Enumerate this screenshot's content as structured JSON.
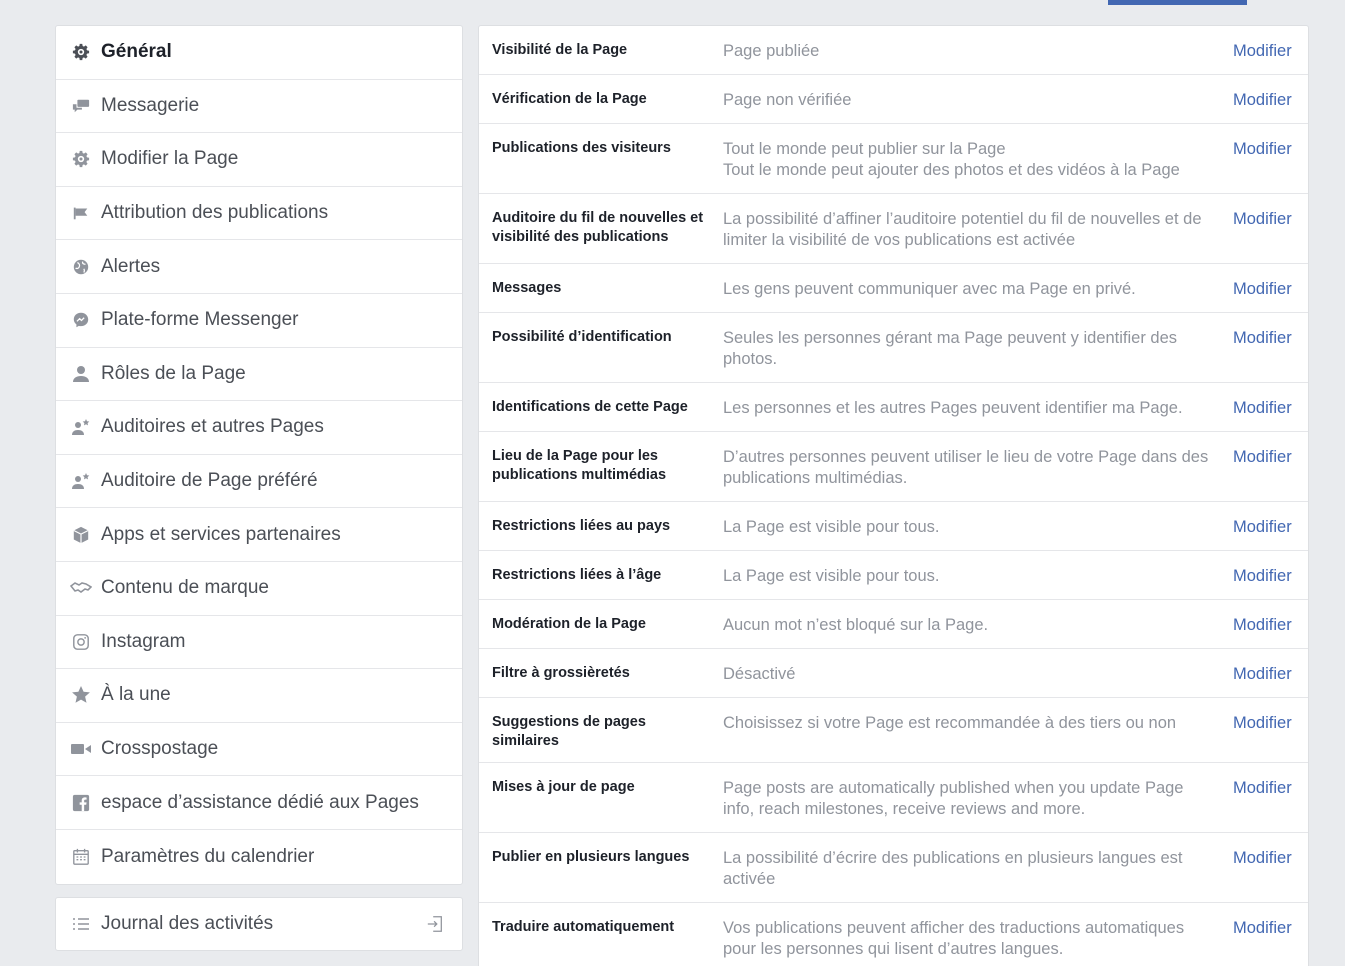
{
  "sidebar": {
    "items": [
      {
        "label": "Général",
        "icon": "gear-icon",
        "active": true
      },
      {
        "label": "Messagerie",
        "icon": "chat-bubbles-icon"
      },
      {
        "label": "Modifier la Page",
        "icon": "gear-icon"
      },
      {
        "label": "Attribution des publications",
        "icon": "flag-icon"
      },
      {
        "label": "Alertes",
        "icon": "globe-icon"
      },
      {
        "label": "Plate-forme Messenger",
        "icon": "messenger-icon"
      },
      {
        "label": "Rôles de la Page",
        "icon": "person-icon"
      },
      {
        "label": "Auditoires et autres Pages",
        "icon": "people-star-icon"
      },
      {
        "label": "Auditoire de Page préféré",
        "icon": "people-star-icon"
      },
      {
        "label": "Apps et services partenaires",
        "icon": "cube-icon"
      },
      {
        "label": "Contenu de marque",
        "icon": "handshake-icon"
      },
      {
        "label": "Instagram",
        "icon": "instagram-icon"
      },
      {
        "label": "À la une",
        "icon": "star-icon"
      },
      {
        "label": "Crosspostage",
        "icon": "video-camera-icon"
      },
      {
        "label": "espace d’assistance dédié aux Pages",
        "icon": "facebook-icon"
      },
      {
        "label": "Paramètres du calendrier",
        "icon": "calendar-icon"
      }
    ]
  },
  "activity": {
    "label": "Journal des activités",
    "icon": "list-icon",
    "exit_icon": "exit-icon"
  },
  "settings": [
    {
      "title": "Visibilité de la Page",
      "value": "Page publiée",
      "edit": "Modifier"
    },
    {
      "title": "Vérification de la Page",
      "value": "Page non vérifiée",
      "edit": "Modifier"
    },
    {
      "title": "Publications des visiteurs",
      "value": "Tout le monde peut publier sur la Page",
      "value2": "Tout le monde peut ajouter des photos et des vidéos à la Page",
      "edit": "Modifier"
    },
    {
      "title": "Auditoire du fil de nouvelles et visibilité des publications",
      "value": "La possibilité d’affiner l’auditoire potentiel du fil de nouvelles et de limiter la visibilité de vos publications est activée",
      "edit": "Modifier"
    },
    {
      "title": "Messages",
      "value": "Les gens peuvent communiquer avec ma Page en privé.",
      "edit": "Modifier"
    },
    {
      "title": "Possibilité d’identification",
      "value": "Seules les personnes gérant ma Page peuvent y identifier des photos.",
      "edit": "Modifier"
    },
    {
      "title": "Identifications de cette Page",
      "value": "Les personnes et les autres Pages peuvent identifier ma Page.",
      "edit": "Modifier"
    },
    {
      "title": "Lieu de la Page pour les publications multimédias",
      "value": "D’autres personnes peuvent utiliser le lieu de votre Page dans des publications multimédias.",
      "edit": "Modifier"
    },
    {
      "title": "Restrictions liées au pays",
      "value": "La Page est visible pour tous.",
      "edit": "Modifier"
    },
    {
      "title": "Restrictions liées à l’âge",
      "value": "La Page est visible pour tous.",
      "edit": "Modifier"
    },
    {
      "title": "Modération de la Page",
      "value": "Aucun mot n’est bloqué sur la Page.",
      "edit": "Modifier"
    },
    {
      "title": "Filtre à grossièretés",
      "value": "Désactivé",
      "edit": "Modifier"
    },
    {
      "title": "Suggestions de pages similaires",
      "value": "Choisissez si votre Page est recommandée à des tiers ou non",
      "edit": "Modifier"
    },
    {
      "title": "Mises à jour de page",
      "value": "Page posts are automatically published when you update Page info, reach milestones, receive reviews and more.",
      "edit": "Modifier"
    },
    {
      "title": "Publier en plusieurs langues",
      "value": "La possibilité d’écrire des publications en plusieurs langues est activée",
      "edit": "Modifier"
    },
    {
      "title": "Traduire automatiquement",
      "value": "Vos publications peuvent afficher des traductions automatiques pour les personnes qui lisent d’autres langues.",
      "edit": "Modifier"
    }
  ]
}
